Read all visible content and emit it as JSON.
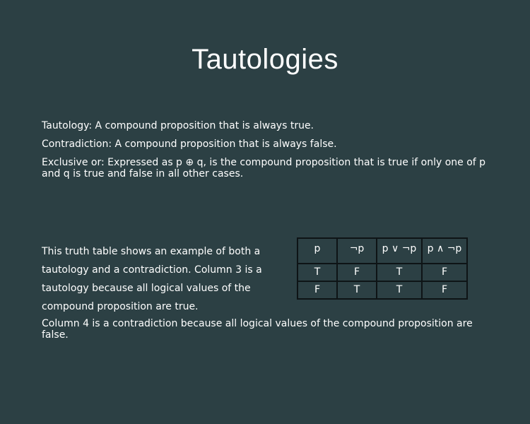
{
  "slide": {
    "title": "Tautologies",
    "definitions": [
      "Tautology: A compound proposition that is always true.",
      "Contradiction: A compound proposition that is always false.",
      "Exclusive or: Expressed as p ⊕ q, is the compound proposition that is true if only one of p and q is true and false in all other cases."
    ],
    "explanation": "This truth table shows an example of both a tautology and a contradiction. Column 3 is a tautology because all logical values of the compound proposition are true.",
    "explanation2": "Column 4 is a contradiction because all logical values of the compound proposition are false.",
    "table": {
      "headers": [
        "p",
        "¬p",
        "p ∨ ¬p",
        "p ∧ ¬p"
      ],
      "rows": [
        [
          "T",
          "F",
          "T",
          "F"
        ],
        [
          "F",
          "T",
          "T",
          "F"
        ]
      ]
    }
  }
}
